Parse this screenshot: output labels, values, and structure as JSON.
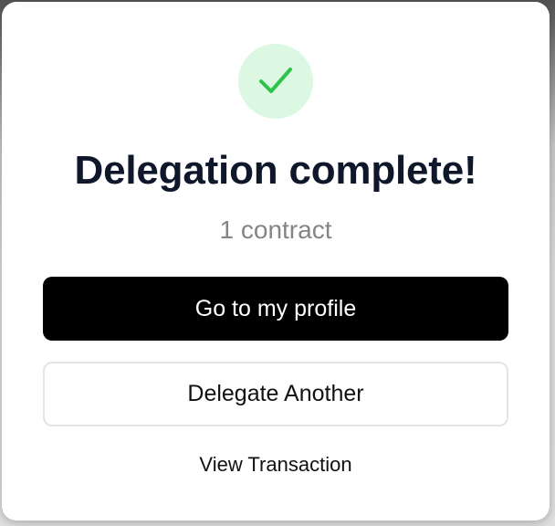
{
  "modal": {
    "title": "Delegation complete!",
    "subtitle": "1 contract",
    "status_icon": "checkmark-icon",
    "accent_green": "#2ec44a",
    "icon_bg": "#dcf8e3"
  },
  "actions": {
    "primary_label": "Go to my profile",
    "secondary_label": "Delegate Another",
    "link_label": "View Transaction"
  }
}
